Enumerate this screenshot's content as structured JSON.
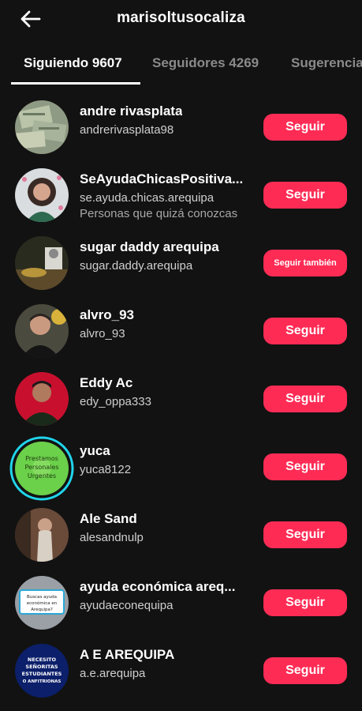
{
  "header": {
    "title": "marisoltusocaliza",
    "back_icon": "arrow-left-icon"
  },
  "tabs": [
    {
      "label": "Siguiendo 9607",
      "active": true
    },
    {
      "label": "Seguidores 4269",
      "active": false
    },
    {
      "label": "Sugerencias",
      "active": false
    }
  ],
  "users": [
    {
      "name": "andre rivasplata",
      "handle": "andrerivasplata98",
      "sub": "",
      "button": "Seguir"
    },
    {
      "name": "SeAyudaChicasPositiva...",
      "handle": "se.ayuda.chicas.arequipa",
      "sub": "Personas que quizá conozcas",
      "button": "Seguir"
    },
    {
      "name": "sugar daddy arequipa",
      "handle": "sugar.daddy.arequipa",
      "sub": "",
      "button": "Seguir también"
    },
    {
      "name": "alvro_93",
      "handle": "alvro_93",
      "sub": "",
      "button": "Seguir"
    },
    {
      "name": "Eddy Ac",
      "handle": "edy_oppa333",
      "sub": "",
      "button": "Seguir"
    },
    {
      "name": "yuca",
      "handle": "yuca8122",
      "sub": "",
      "button": "Seguir",
      "avatar_text": "Prestamos Personales Urgentes"
    },
    {
      "name": "Ale Sand",
      "handle": "alesandnulp",
      "sub": "",
      "button": "Seguir"
    },
    {
      "name": "ayuda económica areq...",
      "handle": "ayudaeconequipa",
      "sub": "",
      "button": "Seguir",
      "avatar_text": "Buscas ayuda económica en Arequipa?"
    },
    {
      "name": "A E AREQUIPA",
      "handle": "a.e.arequipa",
      "sub": "",
      "button": "Seguir",
      "avatar_text": "NECESITO SEÑORITAS ESTUDIANTES O ANFITRIONAS"
    }
  ],
  "colors": {
    "background": "#121212",
    "accent": "#fe2c55",
    "text_primary": "#ffffff",
    "text_muted": "#8a8a8a"
  }
}
